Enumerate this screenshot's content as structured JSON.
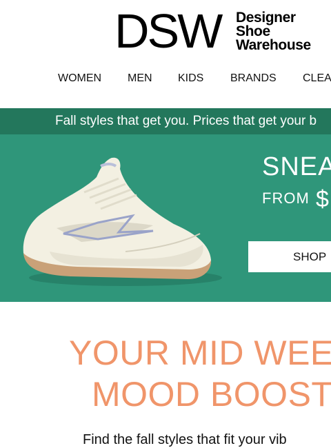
{
  "brand": {
    "logo_mark": "DSW",
    "logo_words": [
      "Designer",
      "Shoe",
      "Warehouse"
    ]
  },
  "nav": {
    "items": [
      {
        "label": "WOMEN"
      },
      {
        "label": "MEN"
      },
      {
        "label": "KIDS"
      },
      {
        "label": "BRANDS"
      },
      {
        "label": "CLEA"
      }
    ]
  },
  "promo": {
    "text": "Fall styles that get you. Prices that get your b"
  },
  "hero": {
    "title": "SNEA",
    "from_label": "FROM",
    "price": "$",
    "shop_label": "SHOP",
    "image_icon": "sneaker-image",
    "background_color": "#2f967a",
    "strip_color": "#23775c"
  },
  "headline": {
    "line1": "YOUR MID WEE",
    "line2": "MOOD BOOST",
    "color": "#f0956a"
  },
  "body": {
    "text": "Find the fall styles that fit your vib"
  }
}
